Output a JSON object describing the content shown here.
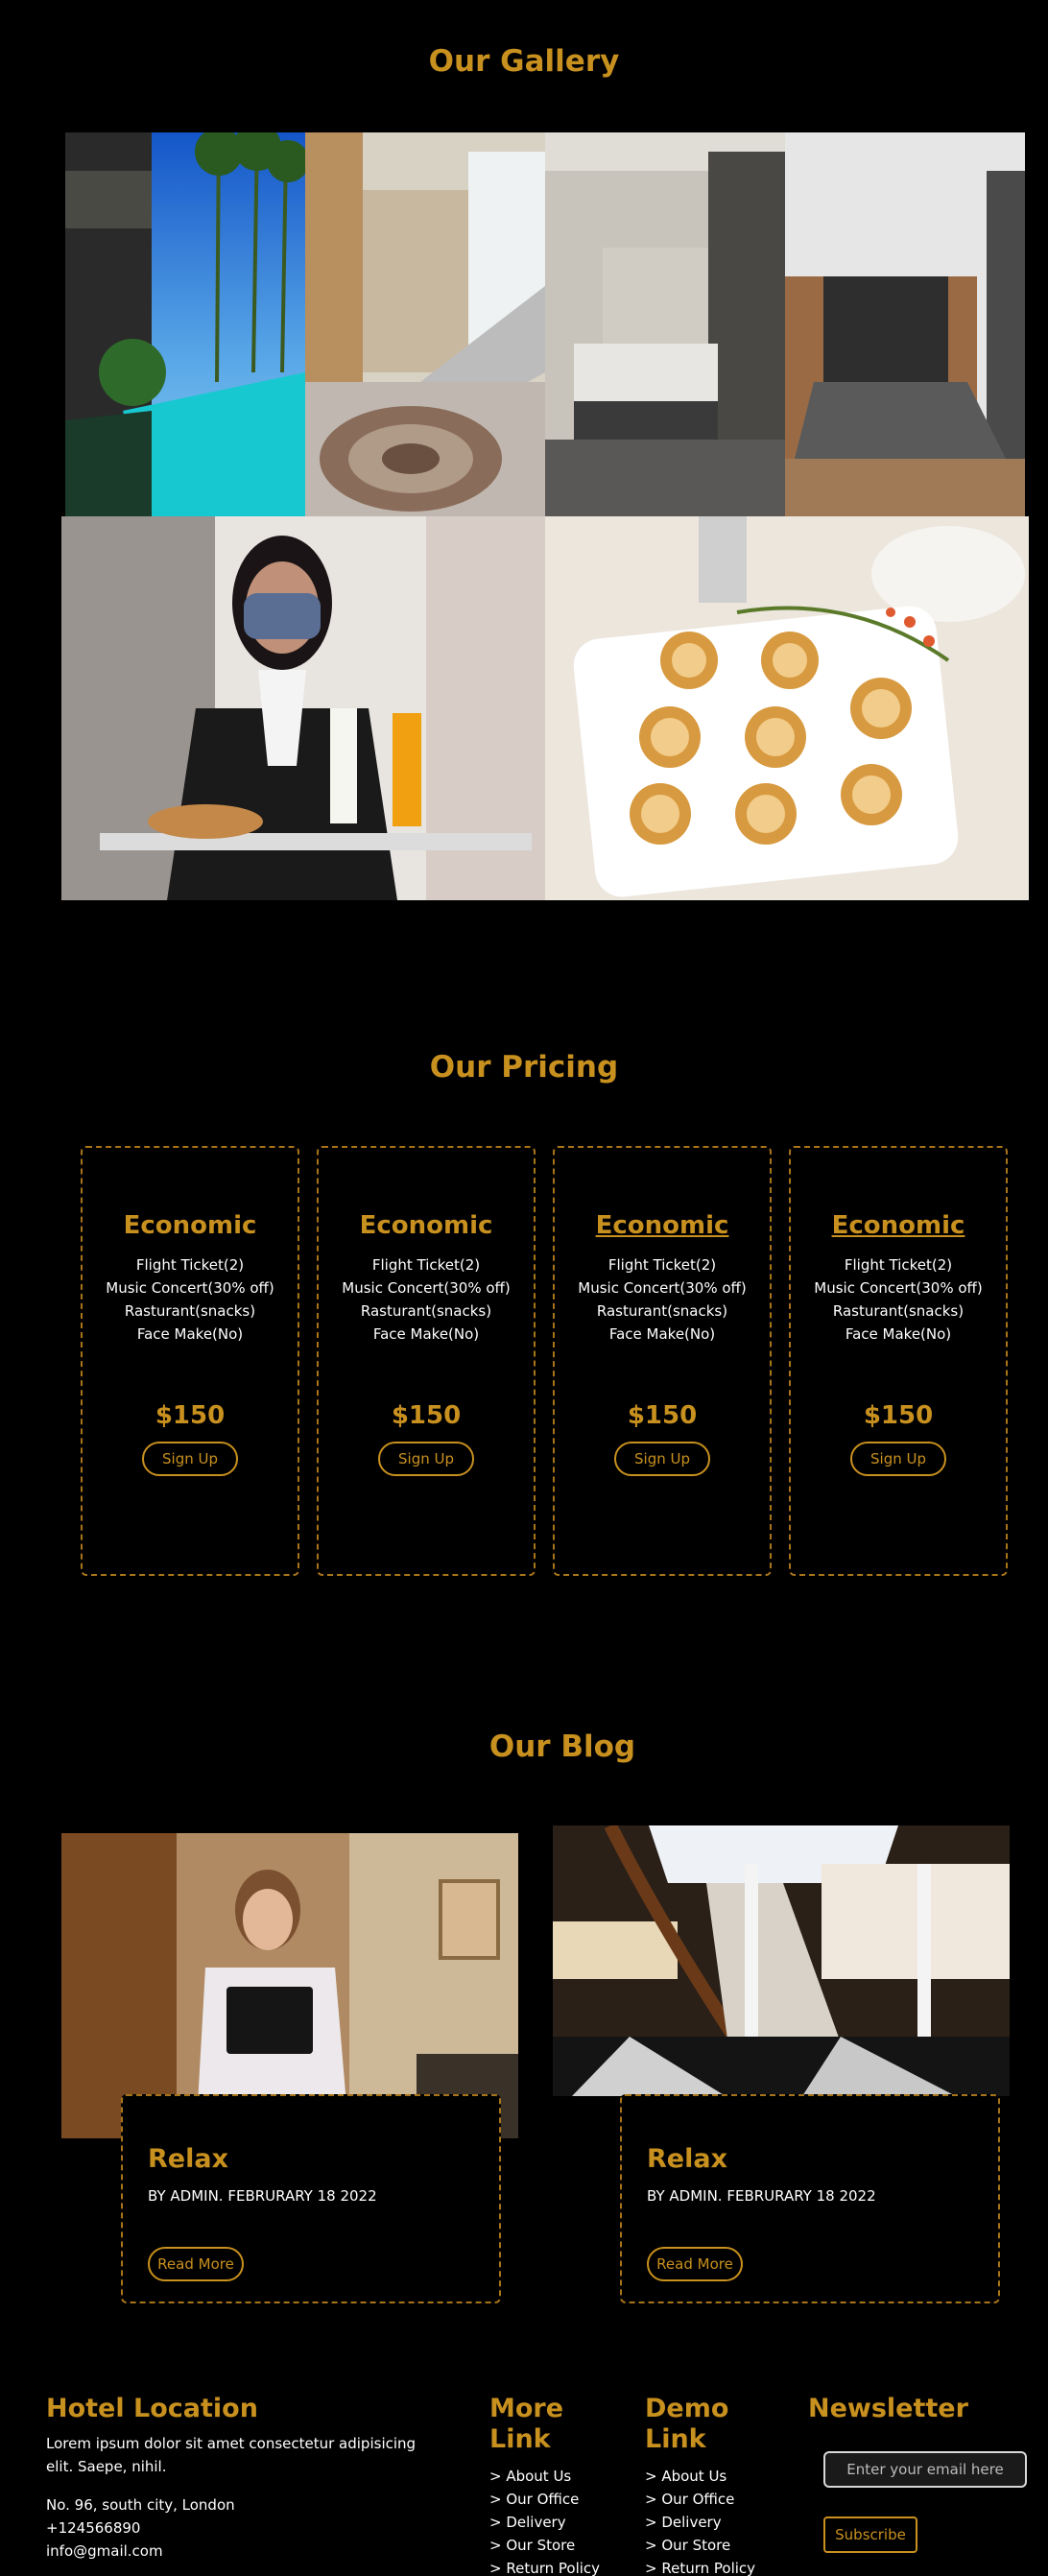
{
  "gallery": {
    "title": "Our Gallery"
  },
  "pricing": {
    "title": "Our Pricing",
    "plans": [
      {
        "name": "Economic",
        "features": [
          "Flight Ticket(2)",
          "Music Concert(30% off)",
          "Rasturant(snacks)",
          "Face Make(No)"
        ],
        "price": "$150",
        "button": "Sign Up"
      },
      {
        "name": "Economic",
        "features": [
          "Flight Ticket(2)",
          "Music Concert(30% off)",
          "Rasturant(snacks)",
          "Face Make(No)"
        ],
        "price": "$150",
        "button": "Sign Up"
      },
      {
        "name": "Economic",
        "features": [
          "Flight Ticket(2)",
          "Music Concert(30% off)",
          "Rasturant(snacks)",
          "Face Make(No)"
        ],
        "price": "$150",
        "button": "Sign Up"
      },
      {
        "name": "Economic",
        "features": [
          "Flight Ticket(2)",
          "Music Concert(30% off)",
          "Rasturant(snacks)",
          "Face Make(No)"
        ],
        "price": "$150",
        "button": "Sign Up"
      }
    ]
  },
  "blog": {
    "title": "Our Blog",
    "posts": [
      {
        "title": "Relax",
        "meta": "BY ADMIN. FEBRURARY 18 2022",
        "button": "Read More"
      },
      {
        "title": "Relax",
        "meta": "BY ADMIN. FEBRURARY 18 2022",
        "button": "Read More"
      }
    ]
  },
  "footer": {
    "location": {
      "heading": "Hotel Location",
      "desc": "Lorem ipsum dolor sit amet consectetur adipisicing elit. Saepe, nihil.",
      "address": "No. 96, south city, London",
      "phone": "+124566890",
      "email": "info@gmail.com"
    },
    "more": {
      "heading_1": "More",
      "heading_2": "Link",
      "links": [
        "> About Us",
        "> Our Office",
        "> Delivery",
        "> Our Store",
        "> Return Policy"
      ]
    },
    "demo": {
      "heading_1": "Demo",
      "heading_2": "Link",
      "links": [
        "> About Us",
        "> Our Office",
        "> Delivery",
        "> Our Store",
        "> Return Policy"
      ]
    },
    "newsletter": {
      "heading": "Newsletter",
      "placeholder": "Enter your email here",
      "button": "Subscribe"
    }
  }
}
